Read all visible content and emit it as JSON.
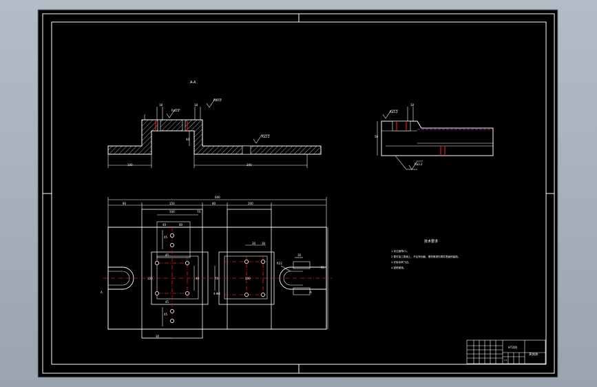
{
  "colors": {
    "background": "#000000",
    "outline": "#ffffff",
    "hatch": "#cfcfcf",
    "centerline": "#e51b1b",
    "hidden_line": "#cc33cc",
    "dimension": "#ffffff",
    "viewer_frame": "#a7afba"
  },
  "section_view": {
    "label": "A-A",
    "roughness_symbols": [
      "Ra3.2",
      "Ra3.2",
      "Ra3.2"
    ],
    "dimensions": [
      "100",
      "200",
      "40",
      "18",
      "18"
    ]
  },
  "side_view": {
    "roughness_symbols": [
      "Ra3.2",
      "Ra3.2"
    ],
    "dimensions": [
      "18",
      "50"
    ]
  },
  "plan_view": {
    "section_marks": [
      "A",
      "A"
    ],
    "dimensions": [
      "600",
      "80",
      "150",
      "80",
      "200",
      "100",
      "70",
      "40",
      "80",
      "45",
      "45",
      "30",
      "30",
      "40",
      "4-Φ8",
      "R22",
      "16",
      "95",
      "70",
      "45",
      "45",
      "120",
      "200",
      "30"
    ]
  },
  "technical_requirements": {
    "heading": "技术要求",
    "items": [
      "1.未注倒角C1。",
      "2.零件加工表面上，不应有划痕、擦伤等损伤零件表面的缺陷。",
      "3.去除毛刺飞边。",
      "4.锐角倒钝。"
    ]
  },
  "title_block": {
    "drawing_name": "夹具体",
    "material": "HT200",
    "scale_row": "1:1"
  }
}
